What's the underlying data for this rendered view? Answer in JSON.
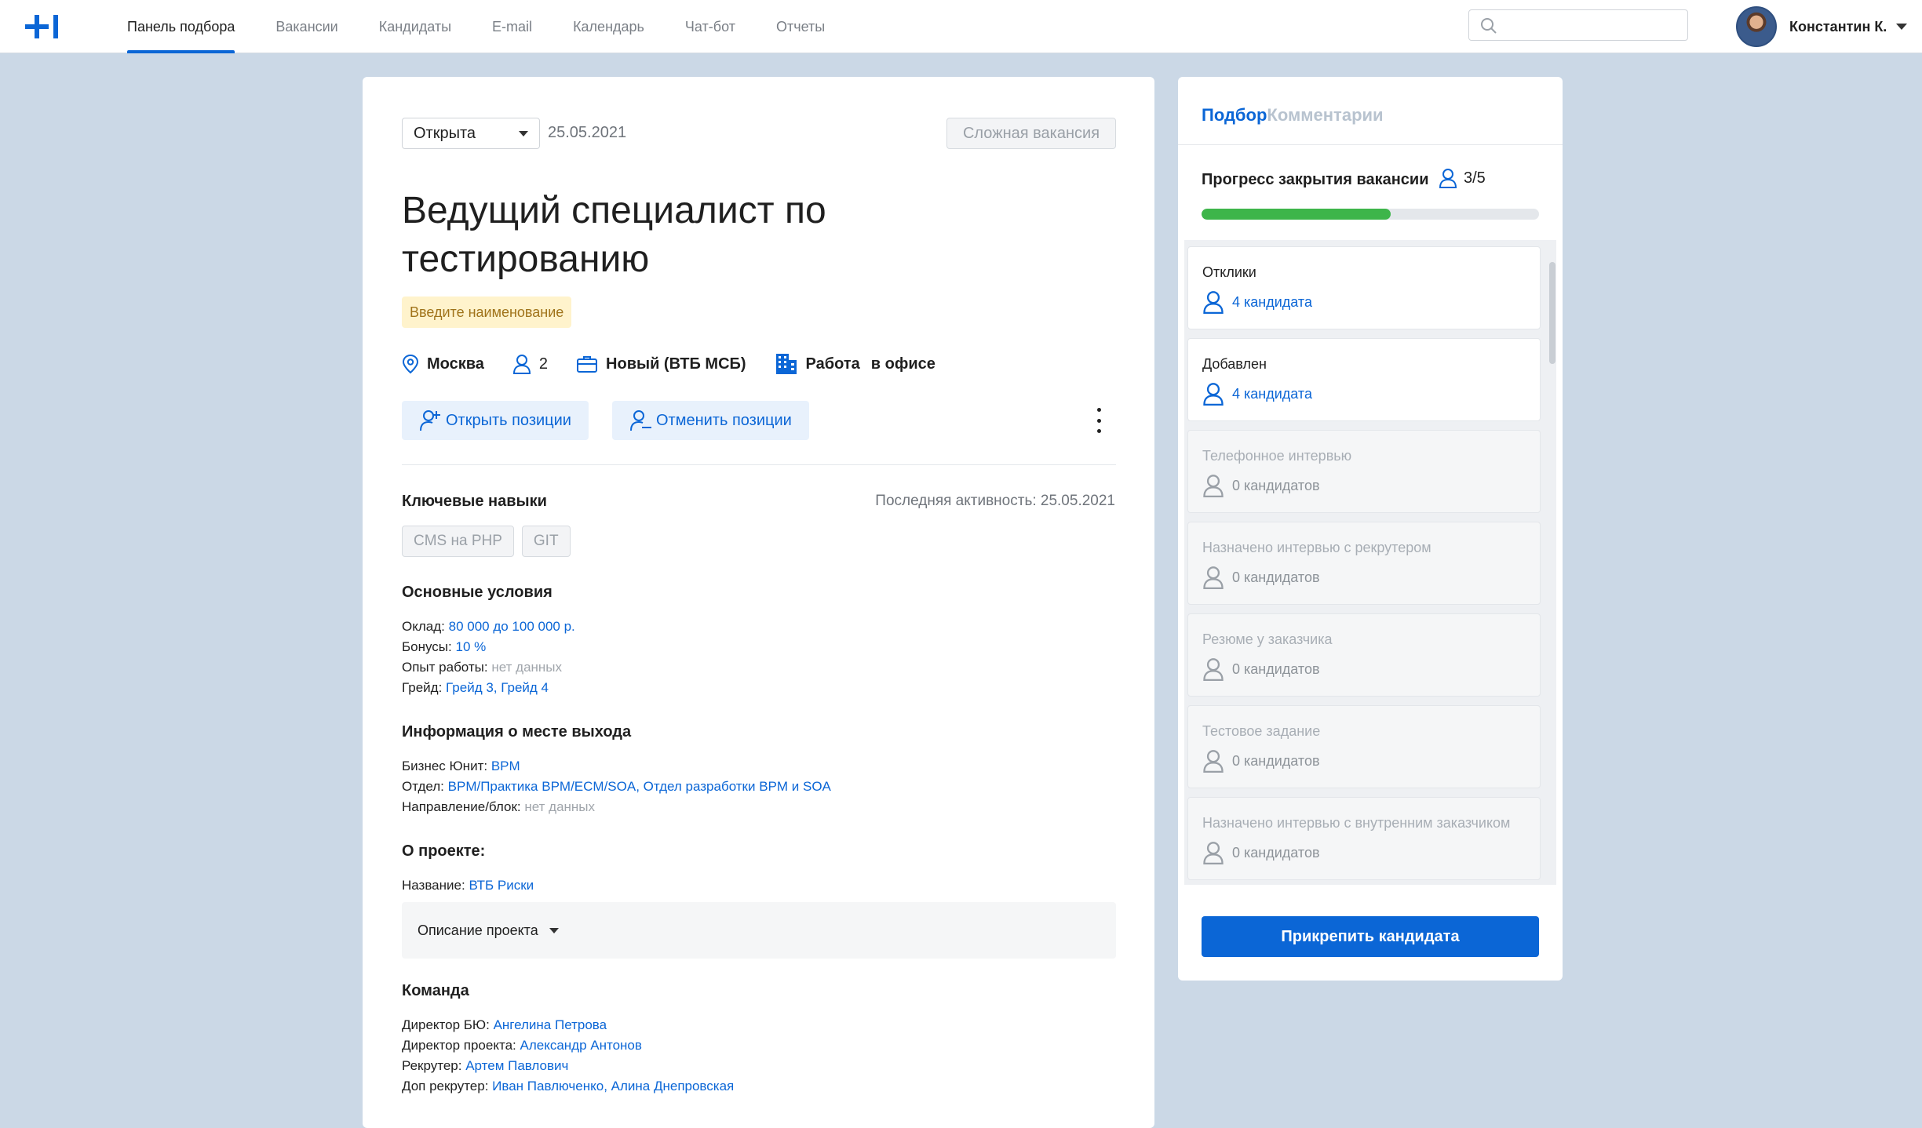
{
  "nav": {
    "items": [
      {
        "label": "Панель подбора",
        "active": true
      },
      {
        "label": "Вакансии"
      },
      {
        "label": "Кандидаты"
      },
      {
        "label": "E-mail"
      },
      {
        "label": "Календарь"
      },
      {
        "label": "Чат-бот"
      },
      {
        "label": "Отчеты"
      }
    ],
    "search_placeholder": "",
    "user_name": "Константин К."
  },
  "vacancy": {
    "status": "Открыта",
    "date": "25.05.2021",
    "complexity_label": "Сложная вакансия",
    "title": "Ведущий специалист по тестированию",
    "name_hint": "Введите наименование",
    "city": "Москва",
    "positions": "2",
    "project_type": "Новый (ВТБ МСБ)",
    "work_label": "Работа",
    "work_mode": "в офисе",
    "open_positions_label": "Открыть позиции",
    "cancel_positions_label": "Отменить позиции",
    "key_skills_title": "Ключевые навыки",
    "last_activity": "Последняя активность: 25.05.2021",
    "skills": [
      "CMS на PHP",
      "GIT"
    ],
    "conditions_title": "Основные условия",
    "conditions": {
      "salary_label": "Оклад:",
      "salary": "80 000 до 100 000 р.",
      "bonus_label": "Бонусы:",
      "bonus": "10 %",
      "experience_label": "Опыт работы:",
      "experience": "нет данных",
      "grade_label": "Грейд:",
      "grade": "Грейд 3, Грейд 4"
    },
    "workplace_title": "Информация о месте выхода",
    "workplace": {
      "bu_label": "Бизнес Юнит:",
      "bu": "BPM",
      "dept_label": "Отдел:",
      "dept": "BPM/Практика BPM/ECM/SOA, Отдел разработки BPM и SOA",
      "direction_label": "Направление/блок:",
      "direction": "нет данных"
    },
    "project_title": "О проекте:",
    "project": {
      "name_label": "Название:",
      "name": "ВТБ Риски",
      "description_label": "Описание проекта"
    },
    "team_title": "Команда",
    "team": {
      "bu_director_label": "Директор БЮ:",
      "bu_director": "Ангелина Петрова",
      "project_director_label": "Директор проекта:",
      "project_director": "Александр Антонов",
      "recruiter_label": "Рекрутер:",
      "recruiter": "Артем Павлович",
      "extra_recruiter_label": "Доп рекрутер:",
      "extra_recruiter": "Иван Павлюченко, Алина Днепровская"
    }
  },
  "side": {
    "tabs": [
      {
        "label": "Подбор",
        "active": true
      },
      {
        "label": "Комментарии"
      }
    ],
    "progress_label": "Прогресс закрытия вакансии",
    "progress_count": "3/5",
    "progress_fraction": 0.56,
    "stages": [
      {
        "name": "Отклики",
        "count": "4 кандидата",
        "active": true
      },
      {
        "name": "Добавлен",
        "count": "4 кандидата",
        "active": true
      },
      {
        "name": "Телефонное интервью",
        "count": "0 кандидатов",
        "active": false
      },
      {
        "name": "Назначено интервью с рекрутером",
        "count": "0 кандидатов",
        "active": false
      },
      {
        "name": "Резюме у заказчика",
        "count": "0 кандидатов",
        "active": false
      },
      {
        "name": "Тестовое задание",
        "count": "0 кандидатов",
        "active": false
      },
      {
        "name": "Назначено интервью с внутренним заказчиком",
        "count": "0 кандидатов",
        "active": false
      }
    ],
    "attach_label": "Прикрепить кандидата"
  },
  "colors": {
    "accent": "#0b66d6",
    "progress": "#3db54a",
    "background": "#cbd8e6"
  }
}
